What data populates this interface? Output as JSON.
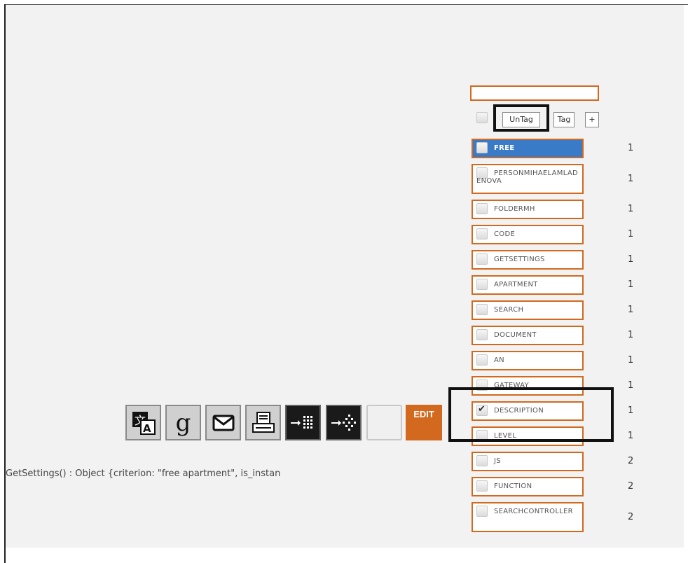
{
  "search": {
    "placeholder": "",
    "value": ""
  },
  "tag_controls": {
    "untag_label": "UnTag",
    "tag_label": "Tag",
    "add_label": "+"
  },
  "tags": [
    {
      "label": "FREE",
      "count": "1",
      "checked": false,
      "active": true
    },
    {
      "label": "PERSONMIHAELAMLADENOVA",
      "count": "1",
      "checked": false,
      "active": false
    },
    {
      "label": "FOLDERMH",
      "count": "1",
      "checked": false,
      "active": false
    },
    {
      "label": "CODE",
      "count": "1",
      "checked": false,
      "active": false
    },
    {
      "label": "GETSETTINGS",
      "count": "1",
      "checked": false,
      "active": false
    },
    {
      "label": "APARTMENT",
      "count": "1",
      "checked": false,
      "active": false
    },
    {
      "label": "SEARCH",
      "count": "1",
      "checked": false,
      "active": false
    },
    {
      "label": "DOCUMENT",
      "count": "1",
      "checked": false,
      "active": false
    },
    {
      "label": "AN",
      "count": "1",
      "checked": false,
      "active": false
    },
    {
      "label": "GATEWAY",
      "count": "1",
      "checked": false,
      "active": false
    },
    {
      "label": "DESCRIPTION",
      "count": "1",
      "checked": true,
      "active": false
    },
    {
      "label": "LEVEL",
      "count": "1",
      "checked": false,
      "active": false
    },
    {
      "label": "JS",
      "count": "2",
      "checked": false,
      "active": false
    },
    {
      "label": "FUNCTION",
      "count": "2",
      "checked": false,
      "active": false
    },
    {
      "label": "SEARCHCONTROLLER",
      "count": "2",
      "checked": false,
      "active": false
    }
  ],
  "toolbar": {
    "buttons": [
      {
        "name": "translate-icon"
      },
      {
        "name": "google-icon",
        "glyph": "g"
      },
      {
        "name": "mail-icon"
      },
      {
        "name": "print-icon"
      },
      {
        "name": "collapse-icon"
      },
      {
        "name": "expand-icon"
      },
      {
        "name": "blank-icon"
      }
    ],
    "edit_label": "EDIT"
  },
  "console": {
    "text": "GetSettings() : Object {criterion: \"free apartment\", is_instan"
  },
  "colors": {
    "accent": "#d2691e",
    "active_tag": "#3a7bc8",
    "panel_bg": "#f2f2f2"
  }
}
